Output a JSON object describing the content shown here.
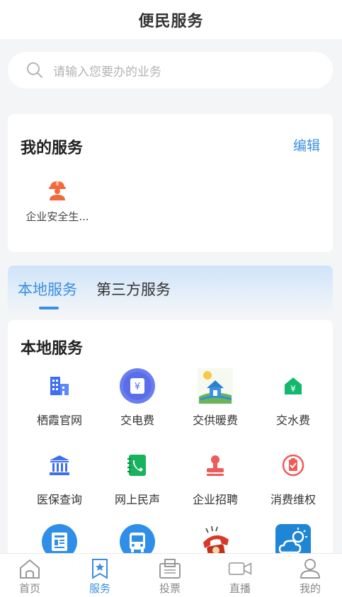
{
  "header": {
    "title": "便民服务"
  },
  "search": {
    "placeholder": "请输入您要办的业务"
  },
  "my_services": {
    "title": "我的服务",
    "edit_label": "编辑",
    "items": [
      {
        "label": "企业安全生...",
        "icon": "worker-helmet-icon"
      }
    ]
  },
  "tabs": [
    {
      "label": "本地服务",
      "active": true
    },
    {
      "label": "第三方服务",
      "active": false
    }
  ],
  "local_services": {
    "title": "本地服务",
    "items": [
      {
        "label": "栖霞官网",
        "icon": "building-icon"
      },
      {
        "label": "交电费",
        "icon": "electricity-fee-icon"
      },
      {
        "label": "交供暖费",
        "icon": "heating-house-icon"
      },
      {
        "label": "交水费",
        "icon": "water-fee-icon"
      },
      {
        "label": "医保查询",
        "icon": "medical-insurance-icon"
      },
      {
        "label": "网上民声",
        "icon": "phone-book-icon"
      },
      {
        "label": "企业招聘",
        "icon": "recruitment-stamp-icon"
      },
      {
        "label": "消费维权",
        "icon": "consumer-rights-icon"
      },
      {
        "label": "",
        "icon": "news-icon"
      },
      {
        "label": "",
        "icon": "bus-icon"
      },
      {
        "label": "",
        "icon": "telephone-icon"
      },
      {
        "label": "",
        "icon": "weather-icon"
      }
    ]
  },
  "tabbar": [
    {
      "label": "首页",
      "icon": "home-icon",
      "active": false
    },
    {
      "label": "服务",
      "icon": "service-icon",
      "active": true
    },
    {
      "label": "投票",
      "icon": "vote-icon",
      "active": false
    },
    {
      "label": "直播",
      "icon": "live-video-icon",
      "active": false
    },
    {
      "label": "我的",
      "icon": "profile-icon",
      "active": false
    }
  ],
  "colors": {
    "accent": "#3b8fe0",
    "background": "#f4f5f7"
  }
}
